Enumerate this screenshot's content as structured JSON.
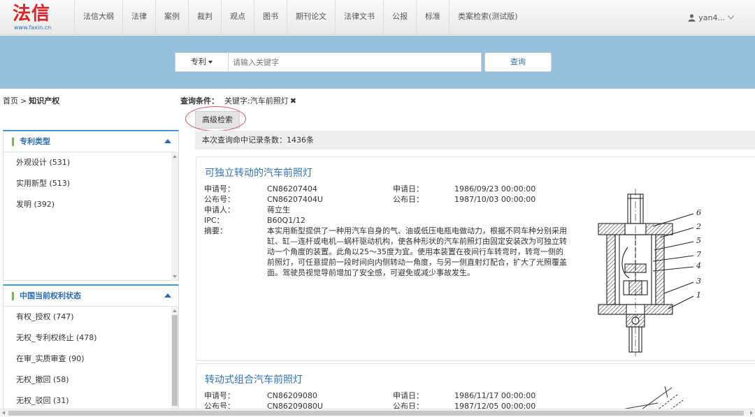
{
  "logo": {
    "cn": "法信",
    "en": "www.faxin.cn"
  },
  "nav": [
    "法信大纲",
    "法律",
    "案例",
    "裁判",
    "观点",
    "图书",
    "期刊论文",
    "法律文书",
    "公报",
    "标准",
    "类案检索(测试版)"
  ],
  "user": {
    "name": "yan4...",
    "icon": "user-icon"
  },
  "search": {
    "type": "专利",
    "placeholder": "请输入关键字",
    "button": "查询"
  },
  "breadcrumb": {
    "home": "首页",
    "sep": ">",
    "current": "知识产权"
  },
  "query": {
    "label": "查询条件：",
    "keyword": "关键字:汽车前照灯",
    "remove": "✖"
  },
  "advanced_search": "高级检索",
  "facets": [
    {
      "title": "专利类型",
      "items": [
        "外观设计 (531)",
        "实用新型 (513)",
        "发明 (392)"
      ]
    },
    {
      "title": "中国当前权利状态",
      "items": [
        "有权_授权 (747)",
        "无权_专利权终止 (478)",
        "在审_实质审查 (90)",
        "无权_撤回 (58)",
        "无权_驳回 (31)"
      ]
    }
  ],
  "result_count": "本次查询命中记录条数：1436条",
  "results": [
    {
      "title": "可独立转动的汽车前照灯",
      "labels": {
        "app_no": "申请号：",
        "pub_no": "公布号：",
        "applicant": "申请人：",
        "ipc": "IPC：",
        "abstract": "摘要：",
        "app_date": "申请日：",
        "pub_date": "公布日："
      },
      "app_no": "CN86207404",
      "pub_no": "CN86207404U",
      "applicant": "蒋立生",
      "ipc": "B60Q1/12",
      "app_date": "1986/09/23 00:00:00",
      "pub_date": "1987/10/03 00:00:00",
      "abstract": "本实用新型提供了一种用汽车自身的气、油或低压电瓶电做动力，根据不同车种分别采用缸、缸—连杆或电机—蜗杆驱动机构，使各种形状的汽车前照灯由固定安装改为可独立转动一个角度的装置。此角以25～35度为宜。使用本装置在夜间行车转弯时，转弯一侧的前照灯，可任意提前一段时间向内侧转动一角度，与另一侧直射灯配合，扩大了光照覆盖面。驾驶员视觉导前增加了安全感，可避免或减少事故发生。",
      "figure_labels": [
        "6",
        "2",
        "5",
        "7",
        "4",
        "3",
        "1"
      ]
    },
    {
      "title": "转动式组合汽车前照灯",
      "labels": {
        "app_no": "申请号：",
        "pub_no": "公布号：",
        "app_date": "申请日：",
        "pub_date": "公布日："
      },
      "app_no": "CN86209080",
      "pub_no": "CN86209080U",
      "app_date": "1986/11/17 00:00:00",
      "pub_date": "1987/12/05 00:00:00"
    }
  ],
  "colors": {
    "brand": "#d7262a",
    "banner": "#95c1dc",
    "link": "#3474b8",
    "accent": "#4b95d2",
    "facet_mark": "#74b957",
    "highlight_circle": "#d85a5a"
  }
}
